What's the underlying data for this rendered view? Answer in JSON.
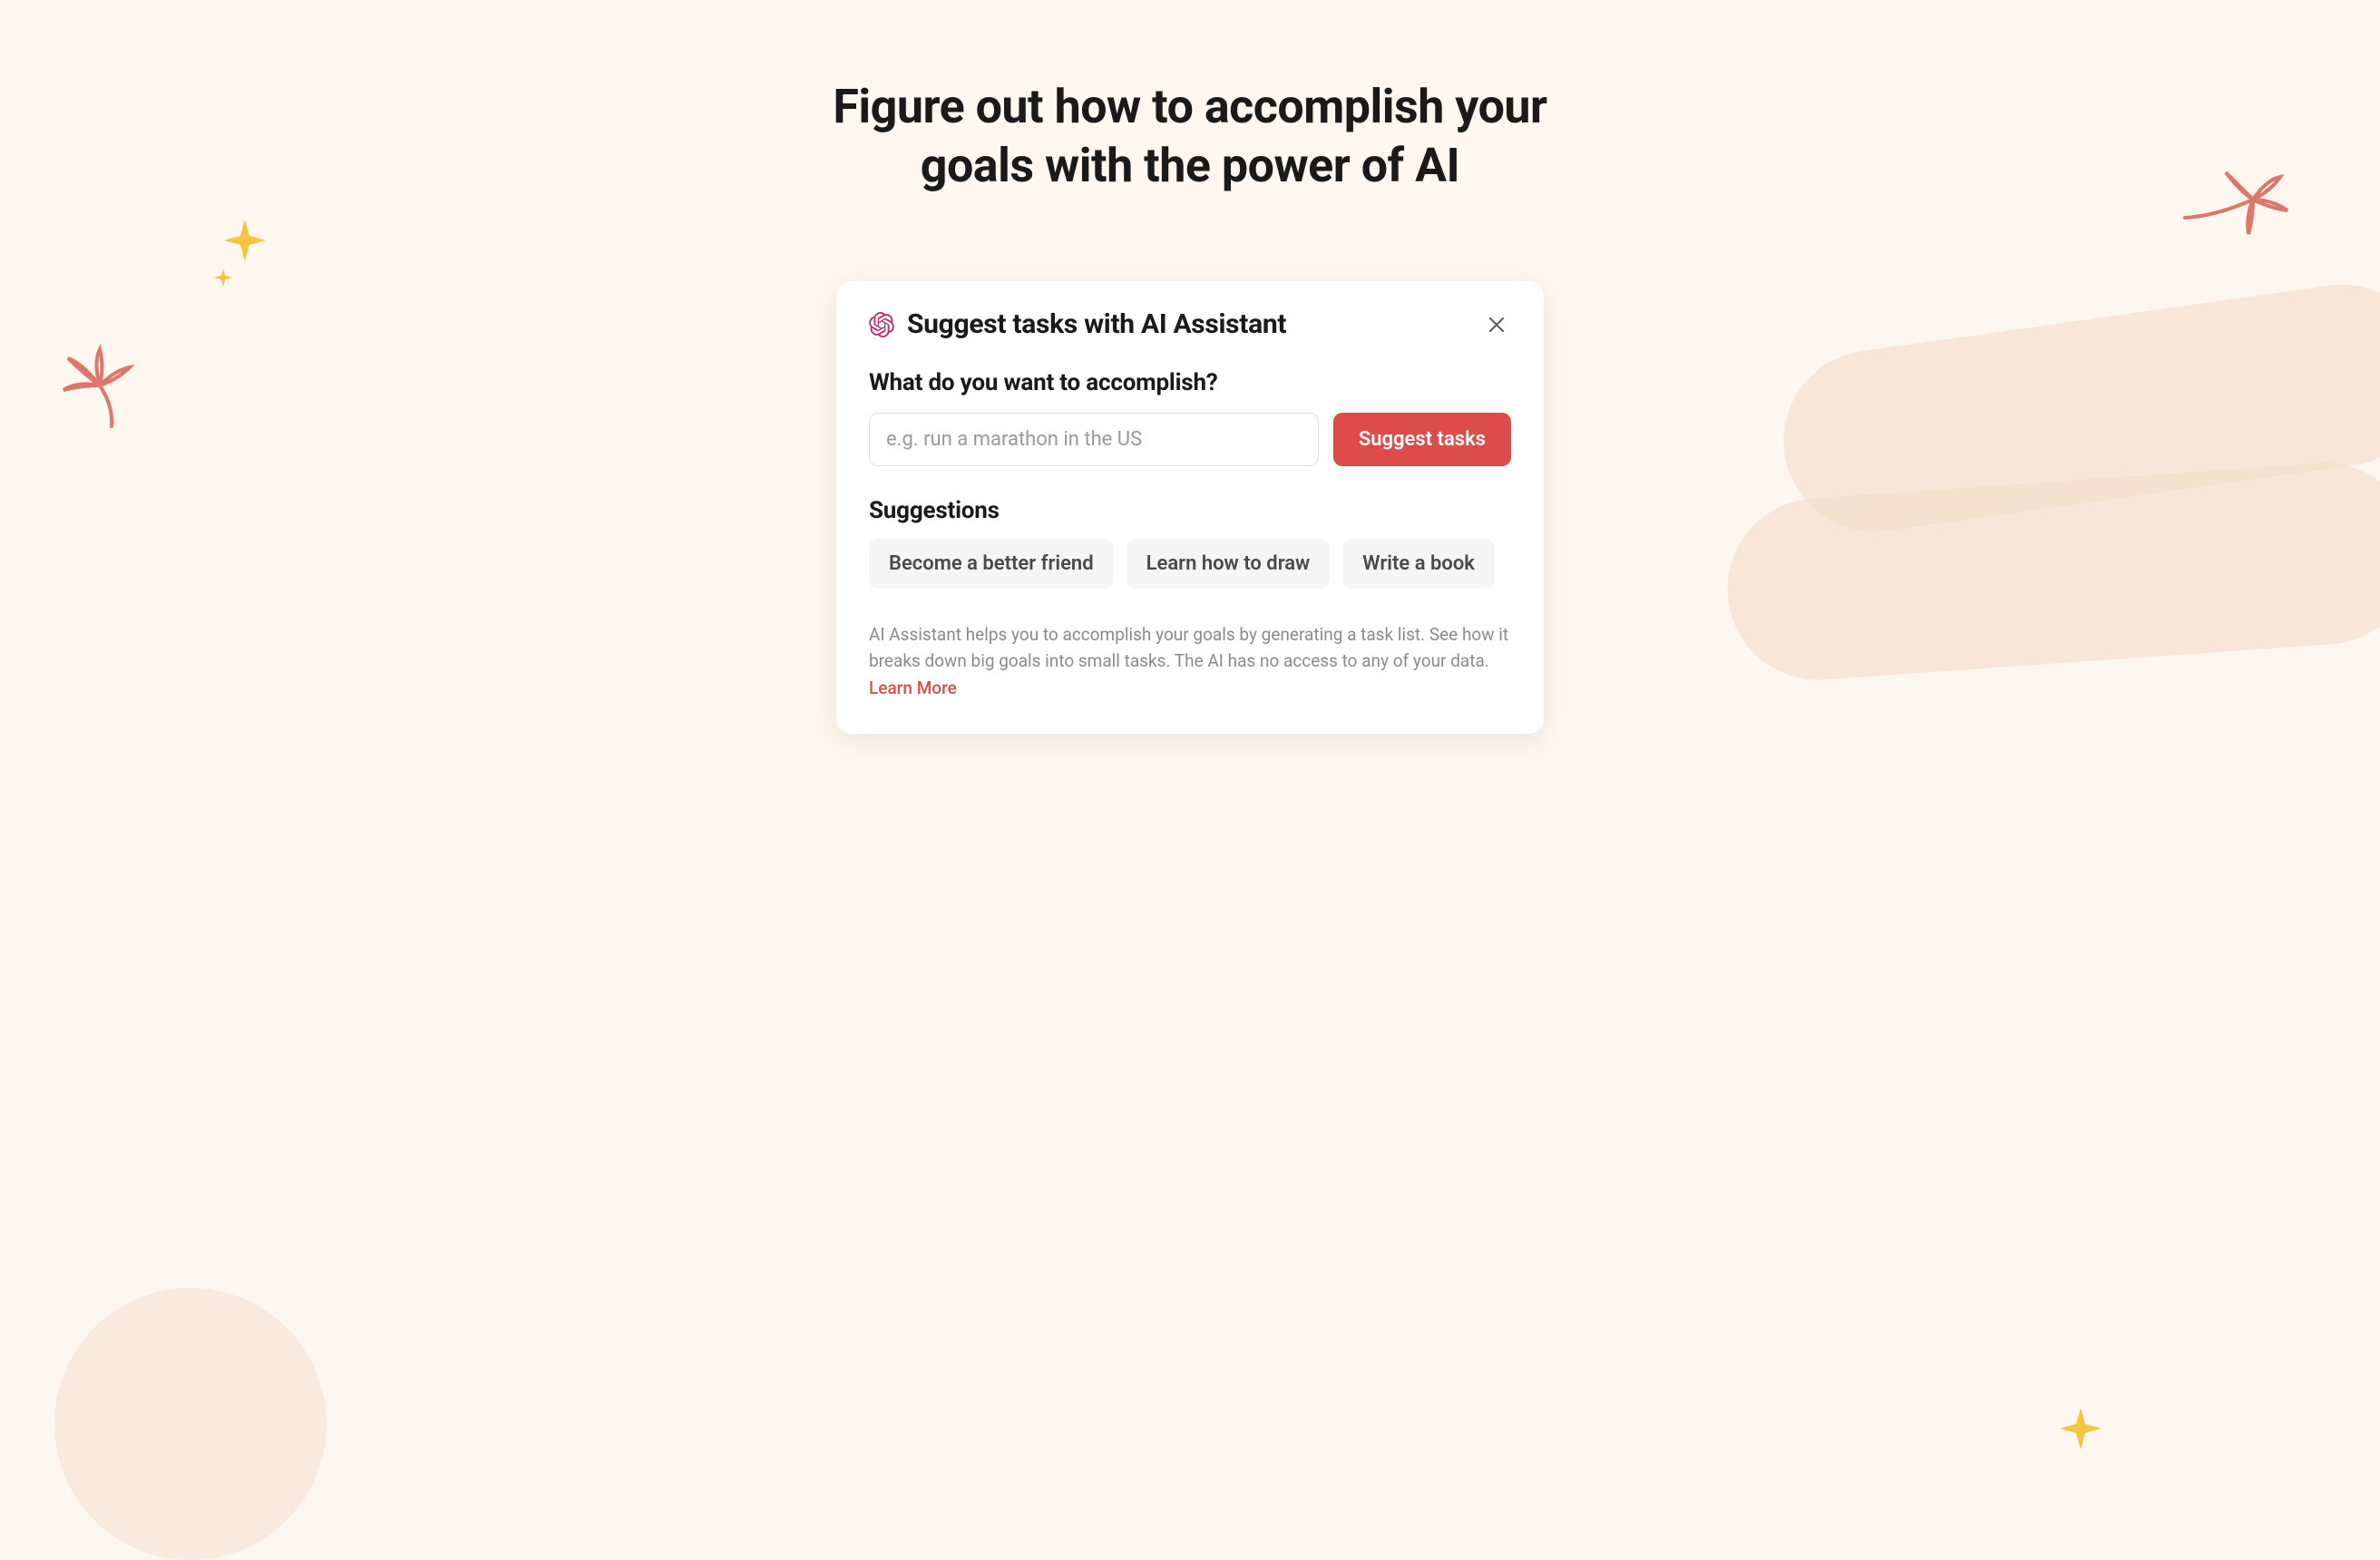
{
  "headline": "Figure out how to accomplish your goals with the power of AI",
  "modal": {
    "title": "Suggest tasks with AI Assistant",
    "prompt_label": "What do you want to accomplish?",
    "input_placeholder": "e.g. run a marathon in the US",
    "input_value": "",
    "suggest_button_label": "Suggest tasks",
    "suggestions_label": "Suggestions",
    "suggestions": [
      "Become a better friend",
      "Learn how to draw",
      "Write a book"
    ],
    "disclaimer": "AI Assistant helps you to accomplish your goals by generating a task list. See how it breaks down big goals into small tasks. The AI has no access to any of your data. ",
    "learn_more_label": "Learn More"
  },
  "colors": {
    "accent": "#de4c4a",
    "background": "#fdf7f0"
  }
}
